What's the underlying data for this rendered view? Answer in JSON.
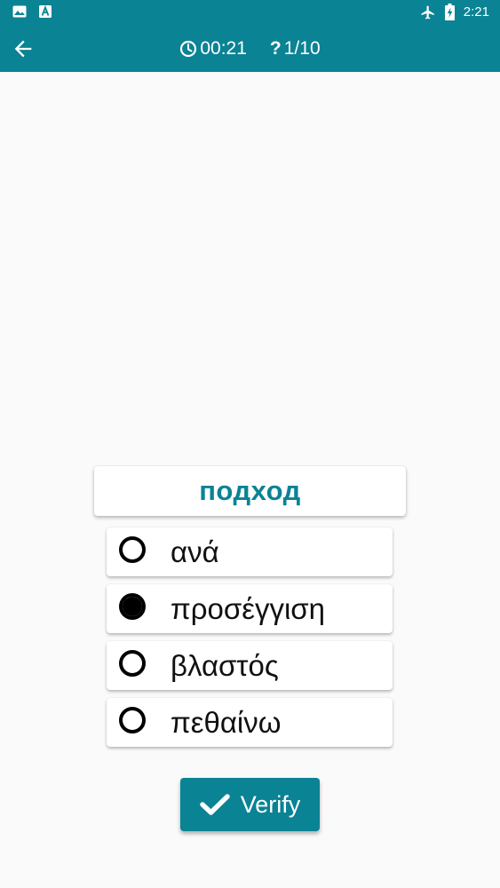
{
  "status_bar": {
    "time": "2:21",
    "icons": [
      "image-icon",
      "font-a-icon",
      "airplane-icon",
      "battery-charging-icon"
    ]
  },
  "app_bar": {
    "back_icon": "back-arrow-icon",
    "timer_icon": "clock-icon",
    "timer": "00:21",
    "question_mark": "?",
    "progress": "1/10"
  },
  "quiz": {
    "word": "подход",
    "options": [
      {
        "label": "ανά",
        "selected": false
      },
      {
        "label": "προσέγγιση",
        "selected": true
      },
      {
        "label": "βλαστός",
        "selected": false
      },
      {
        "label": "πεθαίνω",
        "selected": false
      }
    ]
  },
  "verify_button": {
    "label": "Verify",
    "icon": "checkmark-icon"
  },
  "colors": {
    "primary": "#0a8394",
    "background": "#fafafa",
    "card": "#ffffff"
  }
}
